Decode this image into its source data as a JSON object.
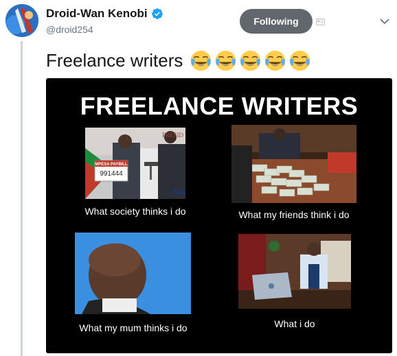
{
  "tweet": {
    "display_name": "Droid-Wan Kenobi",
    "handle": "@droid254",
    "follow_label": "Following",
    "text": "Freelance writers",
    "emojis": [
      "face-with-tears-of-joy",
      "face-with-tears-of-joy",
      "face-with-tears-of-joy",
      "face-with-tears-of-joy",
      "face-with-tears-of-joy"
    ]
  },
  "meme": {
    "title": "FREELANCE WRITERS",
    "panels": [
      {
        "caption": "What society thinks i do",
        "sign_text": "MPESA PAYBILL",
        "sign_number": "991444",
        "bg_text": "PRESID",
        "corner_text": "NA"
      },
      {
        "caption": "What my friends think i do"
      },
      {
        "caption": "What my mum thinks i do"
      },
      {
        "caption": "What i do"
      }
    ]
  },
  "colors": {
    "verified": "#1da1f2",
    "follow_bg": "#62676d",
    "meme_bg": "#000000",
    "thread_line": "#ccd6dd"
  }
}
